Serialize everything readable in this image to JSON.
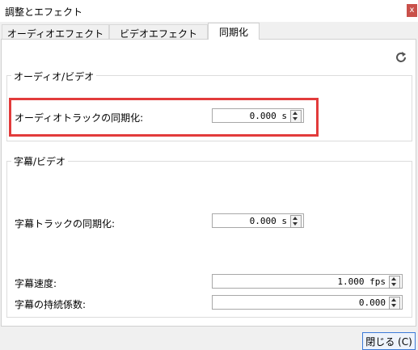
{
  "window": {
    "title": "調整とエフェクト",
    "close_label": "x"
  },
  "tabs": [
    {
      "label": "オーディオエフェクト"
    },
    {
      "label": "ビデオエフェクト"
    },
    {
      "label": "同期化"
    }
  ],
  "audio_video": {
    "title": "オーディオ/ビデオ",
    "sync_label": "オーディオトラックの同期化:",
    "sync_value": "0.000 s"
  },
  "subtitle_video": {
    "title": "字幕/ビデオ",
    "track_sync_label": "字幕トラックの同期化:",
    "track_sync_value": "0.000 s",
    "speed_label": "字幕速度:",
    "speed_value": "1.000 fps",
    "duration_label": "字幕の持続係数:",
    "duration_value": "0.000"
  },
  "footer": {
    "close_button_label": "閉じる (C)"
  },
  "colors": {
    "highlight": "#e23b3b",
    "close_button": "#c9504a"
  }
}
